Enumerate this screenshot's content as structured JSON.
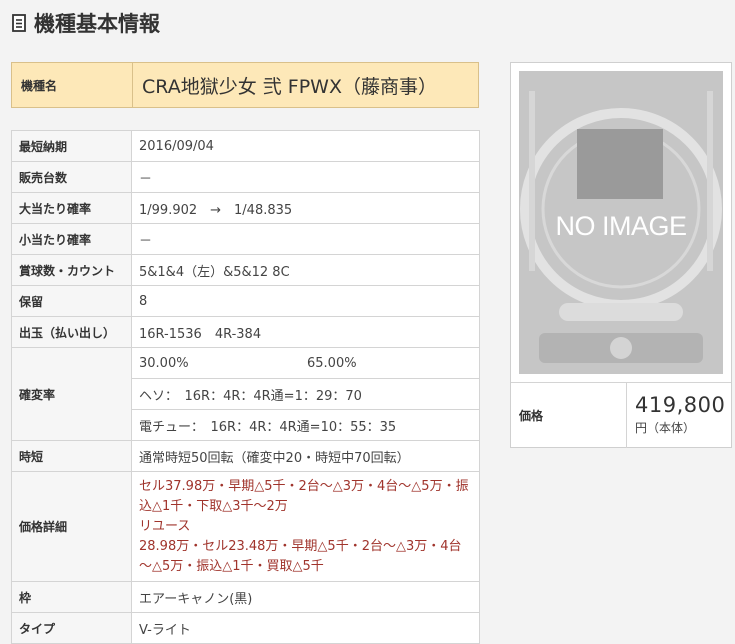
{
  "header": {
    "title": "機種基本情報"
  },
  "model": {
    "label": "機種名",
    "name": "CRA地獄少女 弐 FPWX（藤商事）"
  },
  "spec": {
    "release_label": "最短納期",
    "release": "2016/09/04",
    "sales_label": "販売台数",
    "sales": "－",
    "jackpot_label": "大当たり確率",
    "jackpot": "1/99.902　→　1/48.835",
    "small_label": "小当たり確率",
    "small": "－",
    "payout_label": "賞球数・カウント",
    "payout": "5&1&4（左）&5&12 8C",
    "hold_label": "保留",
    "hold": "8",
    "output_label": "出玉（払い出し）",
    "output": "16R-1536　4R-384",
    "kakuhen_label": "確変率",
    "kakuhen_rate1": "30.00%",
    "kakuhen_rate2": "65.00%",
    "kakuhen_heso": "ヘソ：　16R：4R：4R通=1：29：70",
    "kakuhen_denchu": "電チュー：　16R：4R：4R通=10：55：35",
    "jitan_label": "時短",
    "jitan": "通常時短50回転（確変中20・時短中70回転）",
    "price_detail_label": "価格詳細",
    "price_detail_1": "セル37.98万・早期△5千・2台～△3万・4台～△5万・振込△1千・下取△3千～2万",
    "price_detail_2": "リユース",
    "price_detail_3": "28.98万・セル23.48万・早期△5千・2台～△3万・4台～△5万・振込△1千・買取△5千",
    "frame_label": "枠",
    "frame": "エアーキャノン(黒)",
    "type_label": "タイプ",
    "type": "V-ライト"
  },
  "image": {
    "placeholder": "NO IMAGE"
  },
  "price": {
    "label": "価格",
    "value": "419,800",
    "unit": "円（本体）"
  },
  "colors": {
    "accent_bg": "#fde8b8",
    "accent_border": "#d9c08a",
    "detail_red": "#a0342c"
  }
}
